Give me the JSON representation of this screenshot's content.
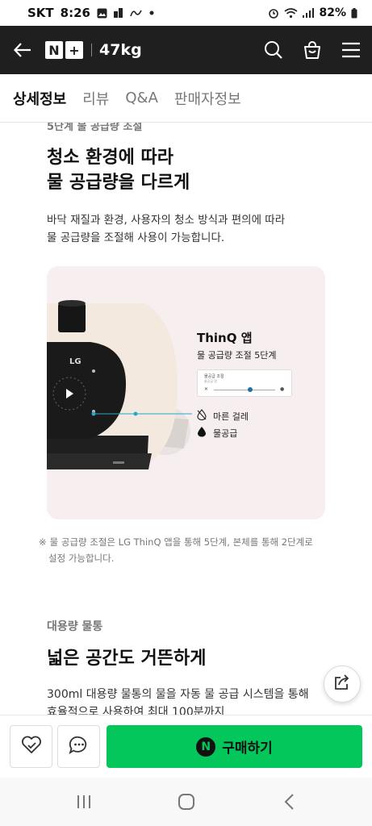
{
  "status_bar": {
    "carrier": "SKT",
    "time": "8:26",
    "battery": "82%",
    "icons": [
      "gallery-icon",
      "signal-bars-icon",
      "notification-icon",
      "dot-icon",
      "alarm-icon",
      "wifi-icon",
      "cell-signal-icon",
      "battery-icon"
    ]
  },
  "header": {
    "logo_n": "N",
    "logo_plus": "+",
    "store_name": "47kg",
    "icons": [
      "back-arrow-icon",
      "search-icon",
      "shopping-bag-icon",
      "menu-icon"
    ]
  },
  "tabs": [
    {
      "label": "상세정보",
      "active": true
    },
    {
      "label": "리뷰",
      "active": false
    },
    {
      "label": "Q&A",
      "active": false
    },
    {
      "label": "판매자정보",
      "active": false
    }
  ],
  "content": {
    "clipped_heading": "5단계 물 공급량 조절",
    "heading_line1": "청소 환경에 따라",
    "heading_line2": "물 공급량을 다르게",
    "desc_line1": "바닥 재질과 환경, 사용자의 청소 방식과 편의에 따라",
    "desc_line2": "물 공급량을 조절해 사용이 가능합니다.",
    "card": {
      "brand": "LG",
      "app_title": "ThinQ 앱",
      "app_subtitle": "물 공급량 조절 5단계",
      "mini_label": "물공급 조절",
      "mini_sub": "물공급 량",
      "legend_dry": "마른 걸레",
      "legend_water": "물공급",
      "colors": {
        "card_bg": "#f7eef0",
        "robot_body": "#f3e9df",
        "accent": "#2aa8c6"
      }
    },
    "note_mark": "※",
    "note_line1": "물 공급량 조절은 LG ThinQ 앱을 통해 5단계, 본체를 통해 2단계로",
    "note_line2": "설정 가능합니다.",
    "section_label": "대용량 물통",
    "heading2": "넓은 공간도 거뜬하게",
    "desc2_line1": "300ml 대용량 물통의 물을 자동 물 공급 시스템을 통해",
    "desc2_line2": "효율적으로 사용하여 최대 100분까지"
  },
  "bottom_bar": {
    "buy_label": "구매하기",
    "buy_logo": "N",
    "icons": [
      "wishlist-heart-icon",
      "chat-icon"
    ],
    "buy_color": "#03c75a"
  },
  "nav_bar": {
    "icons": [
      "recent-apps-icon",
      "home-icon",
      "back-icon"
    ]
  }
}
